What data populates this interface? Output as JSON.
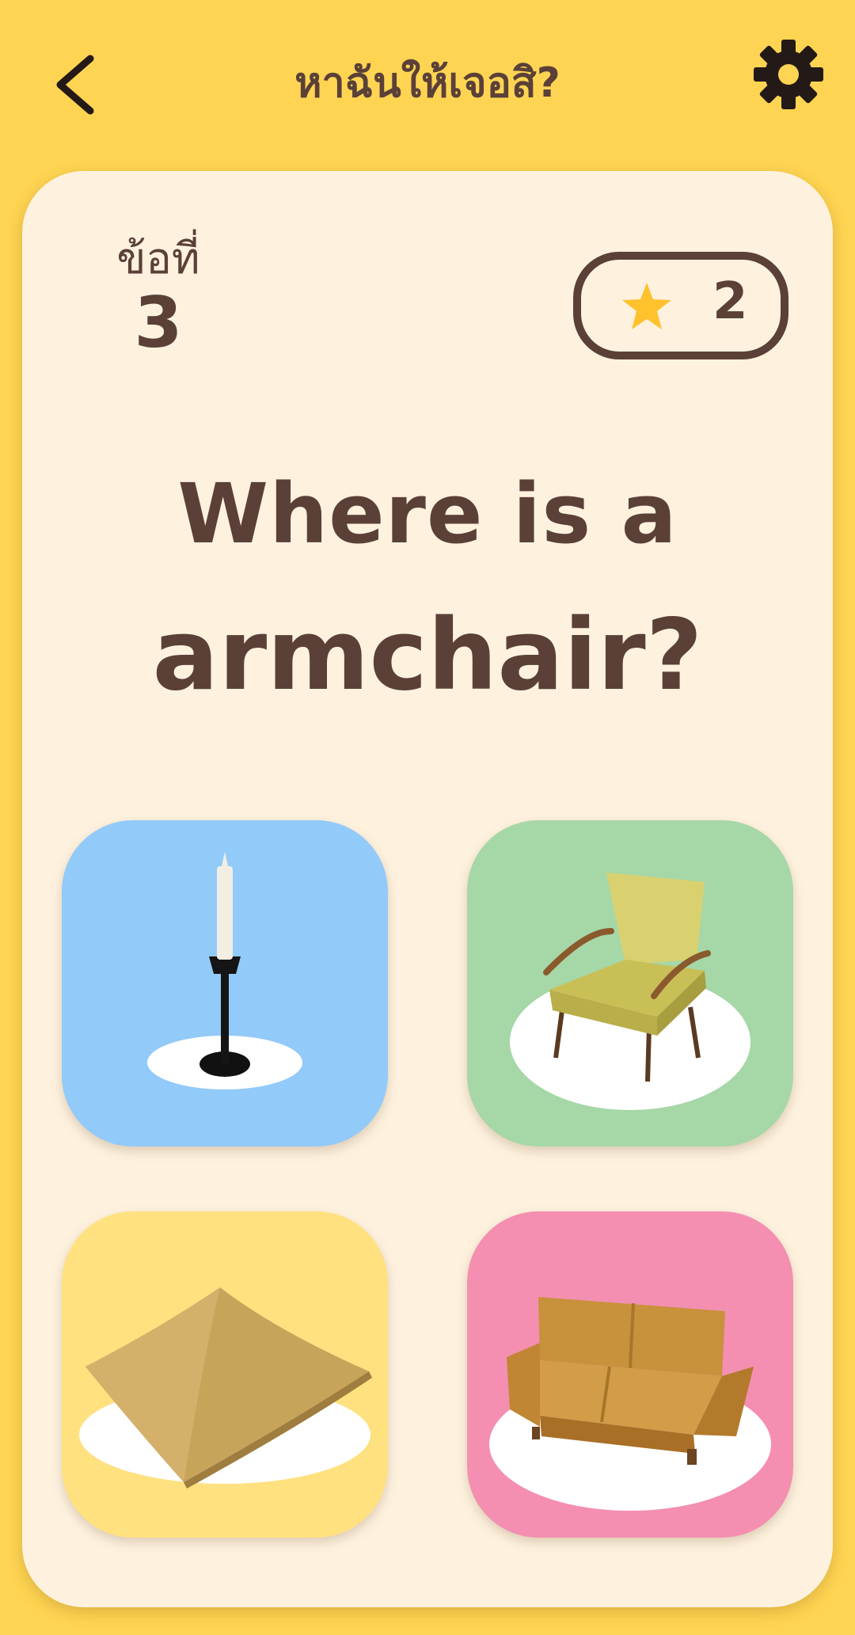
{
  "header": {
    "title": "หาฉันให้เจอสิ?",
    "back_icon": "chevron-left-icon",
    "settings_icon": "gear-icon"
  },
  "question": {
    "label": "ข้อที่",
    "number": "3"
  },
  "score": {
    "icon": "star-icon",
    "value": "2"
  },
  "prompt": {
    "line1": "Where is a",
    "line2": "armchair?"
  },
  "options": [
    {
      "item": "candlestick",
      "color": "#92CAF9"
    },
    {
      "item": "armchair",
      "color": "#A6D7A7"
    },
    {
      "item": "pillow",
      "color": "#FFE180"
    },
    {
      "item": "sofa",
      "color": "#F48FB1"
    }
  ],
  "colors": {
    "background": "#FED452",
    "card": "#FEF2DF",
    "text": "#5B4038",
    "star": "#FFC22D"
  }
}
